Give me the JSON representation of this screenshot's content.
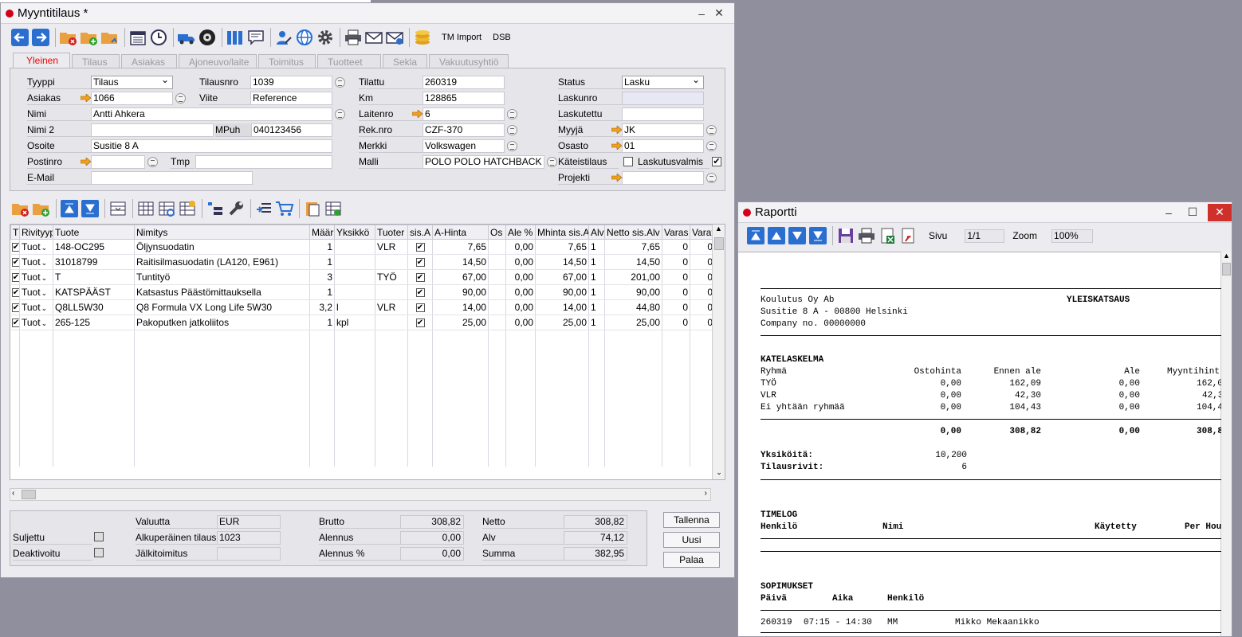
{
  "main": {
    "title": "Myyntitilaus *",
    "toolbar": {
      "tm_import": "TM Import",
      "dsb": "DSB"
    },
    "tabs": [
      "Yleinen",
      "Tilaus",
      "Asiakas",
      "Ajoneuvo/laite",
      "Toimitus",
      "Tuotteet",
      "Sekla",
      "Vakuutusyhtiö"
    ],
    "form": {
      "tyyppi_label": "Tyyppi",
      "tyyppi": "Tilaus",
      "tilausnro_label": "Tilausnro",
      "tilausnro": "1039",
      "tilattu_label": "Tilattu",
      "tilattu": "260319",
      "status_label": "Status",
      "status": "Lasku",
      "asiakas_label": "Asiakas",
      "asiakas": "1066",
      "viite_label": "Viite",
      "viite": "Reference",
      "km_label": "Km",
      "km": "128865",
      "laskunro_label": "Laskunro",
      "laskunro": "",
      "nimi_label": "Nimi",
      "nimi": "Antti Ahkera",
      "laitenro_label": "Laitenro",
      "laitenro": "6",
      "laskutettu_label": "Laskutettu",
      "laskutettu": "",
      "nimi2_label": "Nimi 2",
      "nimi2": "",
      "mpuh_label": "MPuh",
      "mpuh": "040123456",
      "reknro_label": "Rek.nro",
      "reknro": "CZF-370",
      "myyja_label": "Myyjä",
      "myyja": "JK",
      "osoite_label": "Osoite",
      "osoite": "Susitie 8 A",
      "merkki_label": "Merkki",
      "merkki": "Volkswagen",
      "osasto_label": "Osasto",
      "osasto": "01",
      "postinro_label": "Postinro",
      "postinro": "",
      "tmp_label": "Tmp",
      "tmp": "",
      "malli_label": "Malli",
      "malli": "POLO POLO HATCHBACK",
      "kateistilaus_label": "Käteistilaus",
      "laskutusvalmis_label": "Laskutusvalmis",
      "email_label": "E-Mail",
      "email": "",
      "projekti_label": "Projekti",
      "projekti": ""
    },
    "grid": {
      "headers": [
        "T",
        "Rivityyp",
        "Tuote",
        "Nimitys",
        "Määr",
        "Yksikkö",
        "Tuoter",
        "sis.A",
        "A-Hinta",
        "Os",
        "Ale %",
        "Mhinta sis.A",
        "Alv",
        "Netto sis.Alv",
        "Varas",
        "Varat"
      ],
      "rows": [
        {
          "t": "✔",
          "rivityyppi": "Tuot",
          "tuote": "148-OC295",
          "nimitys": "Öljynsuodatin",
          "maara": "1",
          "yksikko": "",
          "tuoter": "VLR",
          "ahinta": "7,65",
          "ale": "0,00",
          "mhinta": "7,65",
          "alv": "1",
          "netto": "7,65",
          "varas": "0",
          "varat": "0"
        },
        {
          "t": "✔",
          "rivityyppi": "Tuot",
          "tuote": "31018799",
          "nimitys": "Raitisilmasuodatin (LA120, E961)",
          "maara": "1",
          "yksikko": "",
          "tuoter": "",
          "ahinta": "14,50",
          "ale": "0,00",
          "mhinta": "14,50",
          "alv": "1",
          "netto": "14,50",
          "varas": "0",
          "varat": "0"
        },
        {
          "t": "✔",
          "rivityyppi": "Tuot",
          "tuote": "T",
          "nimitys": "Tuntityö",
          "maara": "3",
          "yksikko": "",
          "tuoter": "TYÖ",
          "ahinta": "67,00",
          "ale": "0,00",
          "mhinta": "67,00",
          "alv": "1",
          "netto": "201,00",
          "varas": "0",
          "varat": "0"
        },
        {
          "t": "✔",
          "rivityyppi": "Tuot",
          "tuote": "KATSPÄÄST",
          "nimitys": "Katsastus Päästömittauksella",
          "maara": "1",
          "yksikko": "",
          "tuoter": "",
          "ahinta": "90,00",
          "ale": "0,00",
          "mhinta": "90,00",
          "alv": "1",
          "netto": "90,00",
          "varas": "0",
          "varat": "0"
        },
        {
          "t": "✔",
          "rivityyppi": "Tuot",
          "tuote": "Q8LL5W30",
          "nimitys": "Q8 Formula VX Long Life 5W30",
          "maara": "3,2",
          "yksikko": "l",
          "tuoter": "VLR",
          "ahinta": "14,00",
          "ale": "0,00",
          "mhinta": "14,00",
          "alv": "1",
          "netto": "44,80",
          "varas": "0",
          "varat": "0"
        },
        {
          "t": "✔",
          "rivityyppi": "Tuot",
          "tuote": "265-125",
          "nimitys": "Pakoputken jatkoliitos",
          "maara": "1",
          "yksikko": "kpl",
          "tuoter": "",
          "ahinta": "25,00",
          "ale": "0,00",
          "mhinta": "25,00",
          "alv": "1",
          "netto": "25,00",
          "varas": "0",
          "varat": "0"
        }
      ]
    },
    "footer": {
      "suljettu": "Suljettu",
      "deaktivoitu": "Deaktivoitu",
      "valuutta_label": "Valuutta",
      "valuutta": "EUR",
      "alkup_label": "Alkuperäinen tilaus",
      "alkup": "1023",
      "jalki_label": "Jälkitoimitus",
      "jalki": "",
      "brutto_label": "Brutto",
      "brutto": "308,82",
      "alennus_label": "Alennus",
      "alennus": "0,00",
      "alennuspct_label": "Alennus %",
      "alennuspct": "0,00",
      "netto_label": "Netto",
      "netto": "308,82",
      "alv_label": "Alv",
      "alv": "74,12",
      "summa_label": "Summa",
      "summa": "382,95",
      "tallenna": "Tallenna",
      "uusi": "Uusi",
      "palaa": "Palaa"
    }
  },
  "report": {
    "title": "Raportti",
    "sivu_label": "Sivu",
    "sivu": "1/1",
    "zoom_label": "Zoom",
    "zoom": "100%",
    "company": "Koulutus Oy Ab",
    "heading": "YLEISKATSAUS",
    "address": "Susitie 8 A - 00800 Helsinki",
    "company_no": "Company no. 00000000",
    "katelaskelma": "KATELASKELMA",
    "kate_headers": [
      "Ryhmä",
      "Ostohinta",
      "Ennen ale",
      "Ale",
      "Myyntihint"
    ],
    "kate_rows": [
      [
        "TYÖ",
        "0,00",
        "162,09",
        "0,00",
        "162,0"
      ],
      [
        "VLR",
        "0,00",
        "42,30",
        "0,00",
        "42,3"
      ],
      [
        "Ei yhtään ryhmää",
        "0,00",
        "104,43",
        "0,00",
        "104,4"
      ]
    ],
    "kate_total": [
      "0,00",
      "308,82",
      "0,00",
      "308,8"
    ],
    "yksikoita_label": "Yksiköitä:",
    "yksikoita": "10,200",
    "tilausrivit_label": "Tilausrivit:",
    "tilausrivit": "6",
    "timelog": "TIMELOG",
    "timelog_headers": [
      "Henkilö",
      "Nimi",
      "Käytetty",
      "Per Hou"
    ],
    "sopimukset": "SOPIMUKSET",
    "sop_headers": [
      "Päivä",
      "Aika",
      "Henkilö"
    ],
    "sop_row": [
      "260319",
      "07:15 - 14:30",
      "MM",
      "Mikko Mekaanikko"
    ]
  }
}
